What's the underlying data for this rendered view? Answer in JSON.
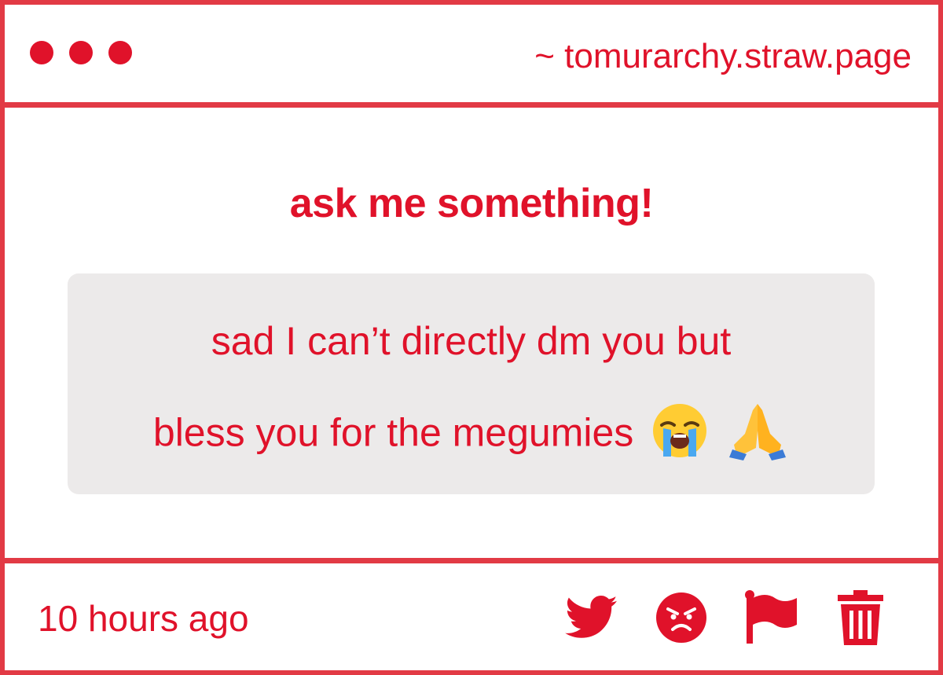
{
  "window": {
    "url": "~ tomurarchy.straw.page"
  },
  "main": {
    "prompt": "ask me something!",
    "message": {
      "line1": "sad I can’t directly dm you but",
      "line2": "bless you for the megumies",
      "emojis": [
        "loudly-crying-face-emoji",
        "folded-hands-emoji"
      ]
    }
  },
  "footer": {
    "timestamp": "10 hours ago",
    "actions": [
      "twitter-icon",
      "angry-face-icon",
      "flag-icon",
      "trash-icon"
    ]
  },
  "colors": {
    "accent": "#e0122a",
    "border": "#e23a45",
    "message_bg": "#eceaea"
  }
}
